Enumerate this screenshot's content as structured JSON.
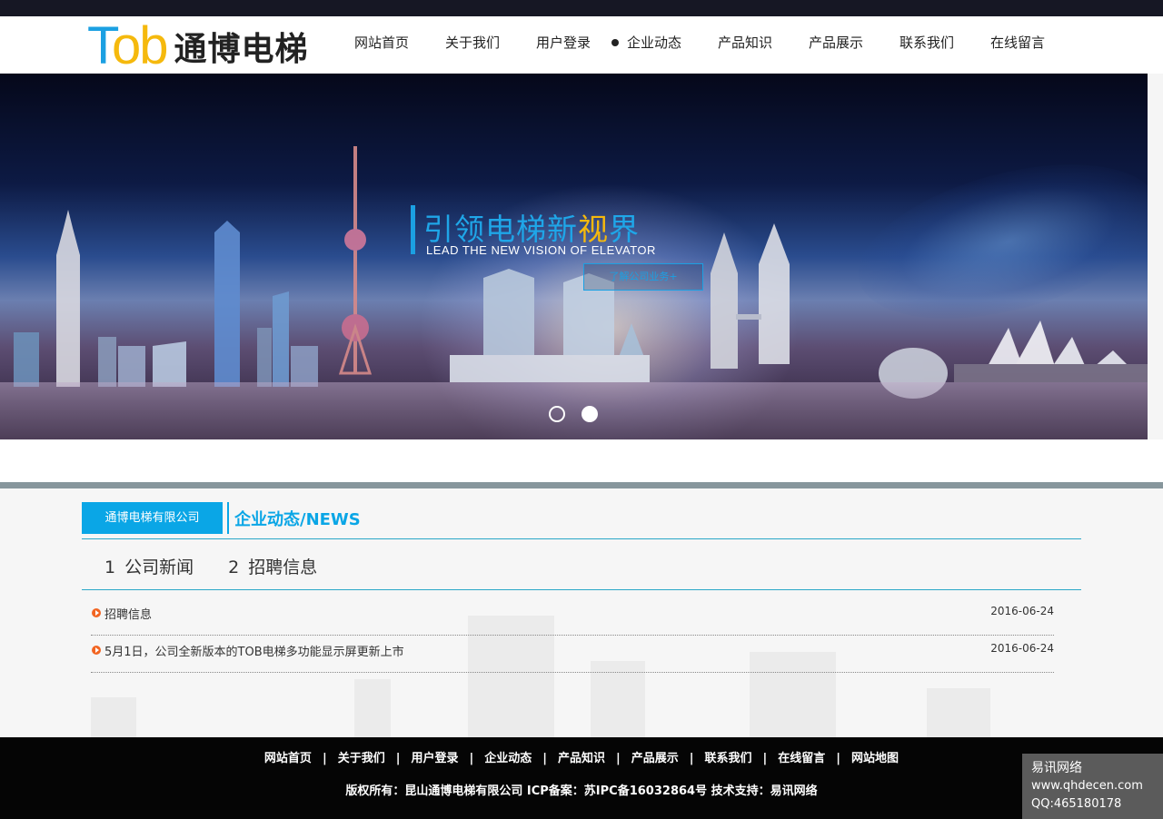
{
  "header": {
    "logo_en_part1": "T",
    "logo_en_part2": "ob",
    "logo_cn": "通博电梯",
    "nav": [
      {
        "label": "网站首页"
      },
      {
        "label": "关于我们"
      },
      {
        "label": "用户登录"
      },
      {
        "label": "企业动态",
        "active": true
      },
      {
        "label": "产品知识"
      },
      {
        "label": "产品展示"
      },
      {
        "label": "联系我们"
      },
      {
        "label": "在线留言"
      }
    ]
  },
  "banner": {
    "slogan_cn_main": "引领电梯新",
    "slogan_cn_highlight": "视",
    "slogan_cn_end": "界",
    "slogan_en": "LEAD THE NEW VISION OF ELEVATOR",
    "button_label": "了解公司业务+",
    "slide_count": 2,
    "active_slide": 2
  },
  "news_section": {
    "company_tab": "通博电梯有限公司",
    "title": "企业动态/NEWS",
    "tabs": [
      {
        "num": "1",
        "label": "公司新闻"
      },
      {
        "num": "2",
        "label": "招聘信息"
      }
    ],
    "items": [
      {
        "title": "招聘信息",
        "date": "2016-06-24"
      },
      {
        "title": "5月1日，公司全新版本的TOB电梯多功能显示屏更新上市",
        "date": "2016-06-24"
      }
    ]
  },
  "footer": {
    "nav": [
      "网站首页",
      "关于我们",
      "用户登录",
      "企业动态",
      "产品知识",
      "产品展示",
      "联系我们",
      "在线留言",
      "网站地图"
    ],
    "separator": "|",
    "copyright": "版权所有：昆山通博电梯有限公司   ICP备案：苏IPC备16032864号  技术支持：易讯网络"
  },
  "watermark": {
    "line1": "易讯网络",
    "line2": "www.qhdecen.com",
    "line3": "QQ:465180178"
  },
  "colors": {
    "accent": "#0aa6e6",
    "logo_blue": "#1ba0e2",
    "logo_yellow": "#f5b90d",
    "bullet": "#f26522"
  }
}
